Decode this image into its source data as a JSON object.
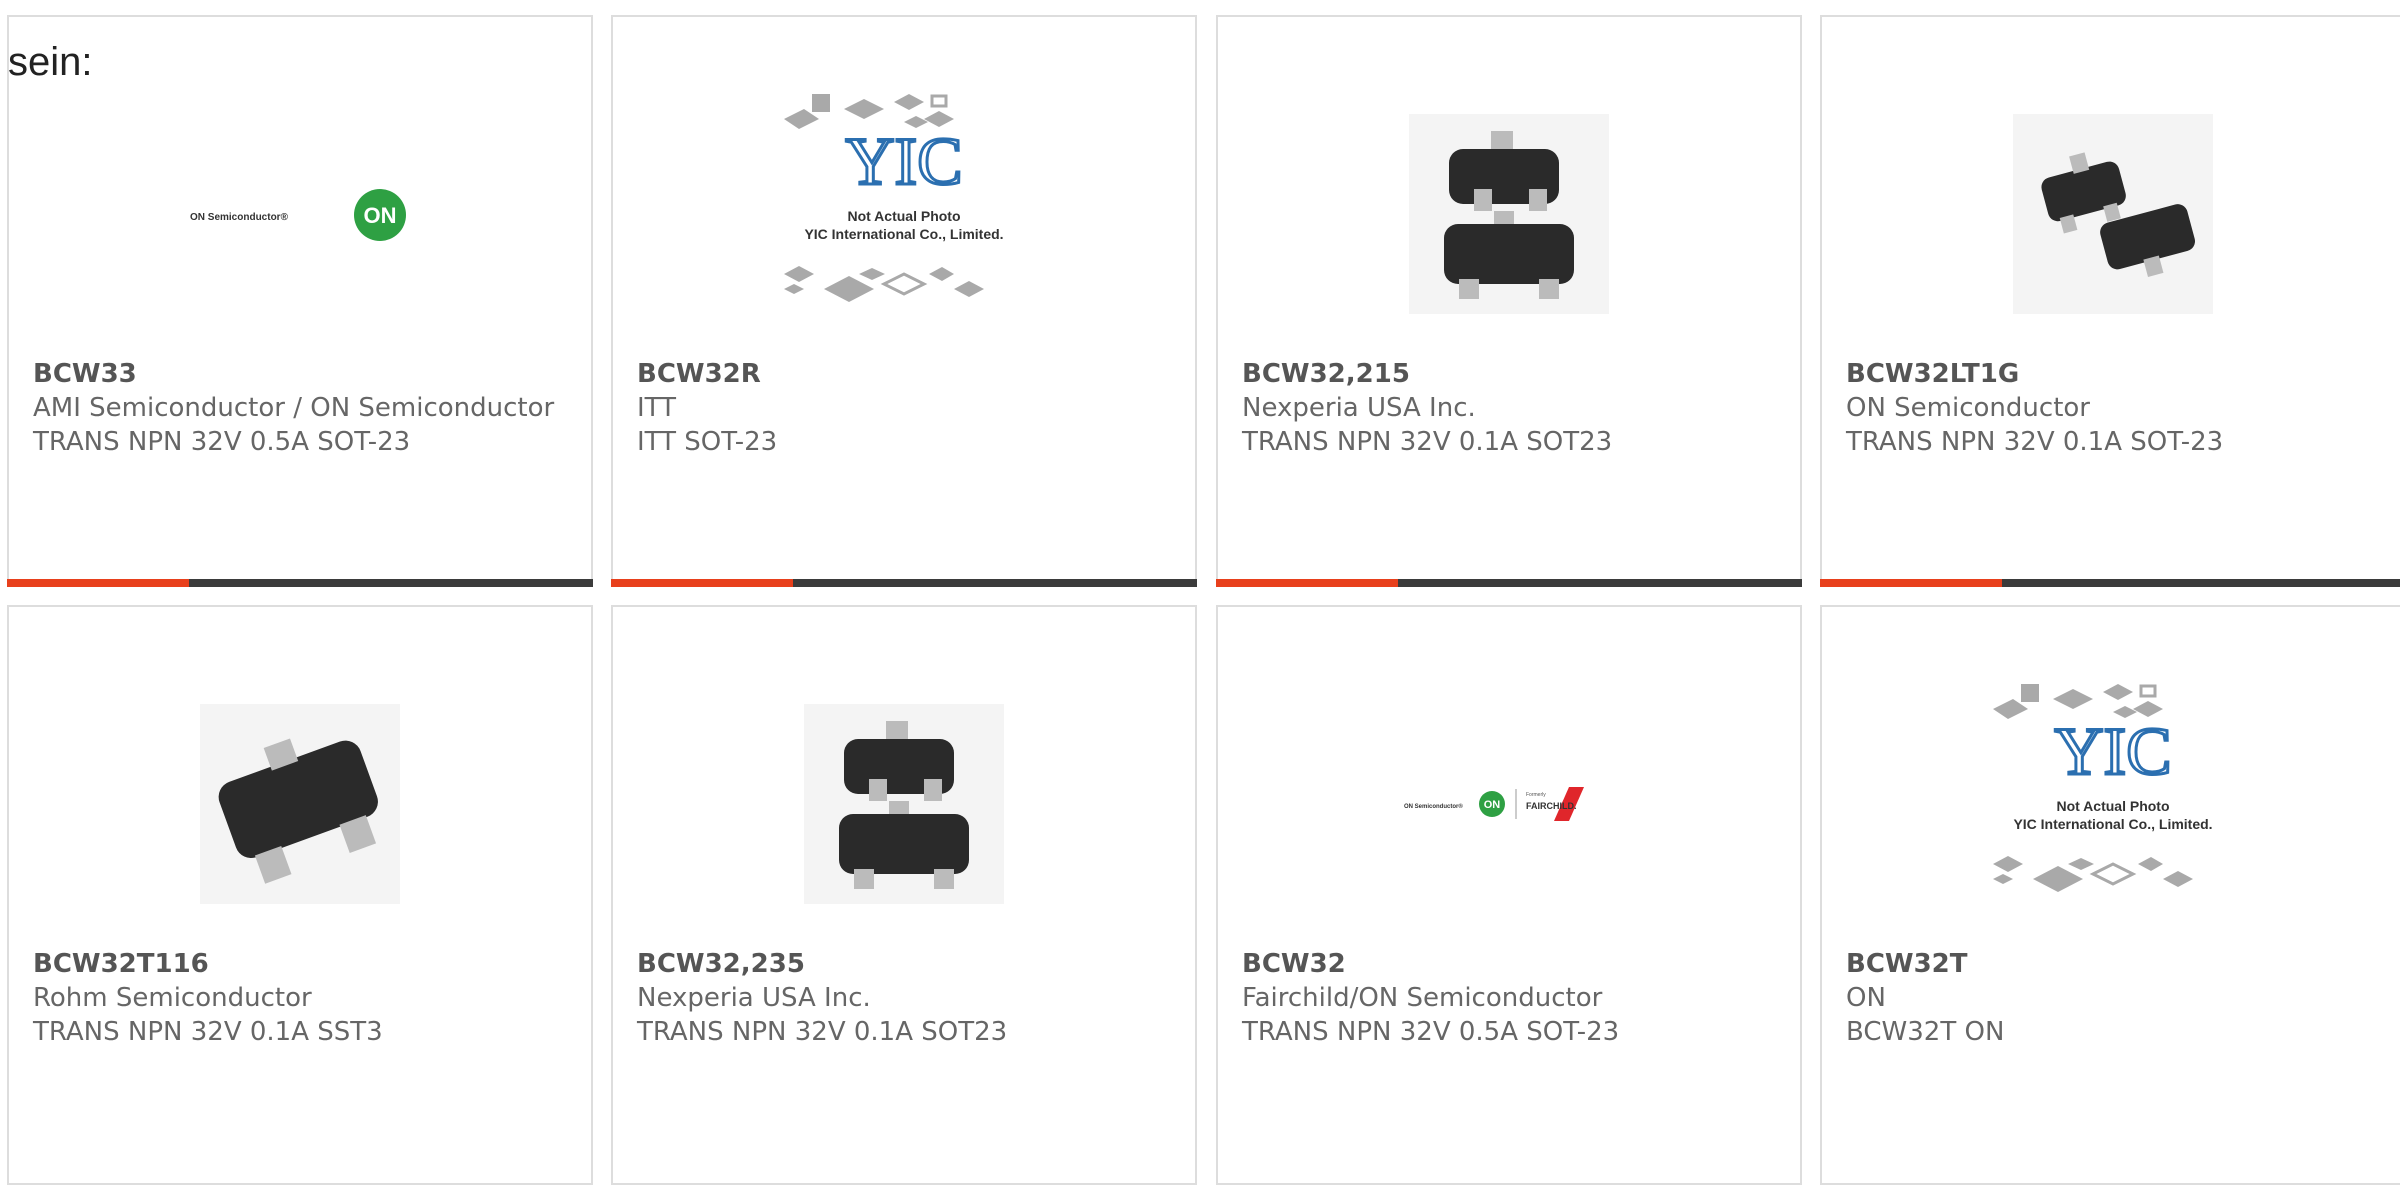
{
  "heading": "sein:",
  "not_actual_photo": {
    "logo": "YIC",
    "line1": "Not Actual Photo",
    "line2": "YIC International Co., Limited."
  },
  "colors": {
    "accent": "#e8401c",
    "bar_dark": "#3b3b3b",
    "on_green": "#2ea043",
    "fairchild_red": "#e0262b"
  },
  "logos": {
    "on_semi_text": "ON Semiconductor®",
    "on_badge": "ON",
    "fairchild_formerly": "Formerly",
    "fairchild_name": "FAIRCHILD."
  },
  "products": [
    {
      "part": "BCW33",
      "manufacturer": "AMI Semiconductor / ON Semiconductor",
      "description": "TRANS NPN 32V 0.5A SOT-23",
      "image": "on-semiconductor-logo"
    },
    {
      "part": "BCW32R",
      "manufacturer": "ITT",
      "description": "ITT SOT-23",
      "image": "not-actual-photo"
    },
    {
      "part": "BCW32,215",
      "manufacturer": "Nexperia USA Inc.",
      "description": "TRANS NPN 32V 0.1A SOT23",
      "image": "sot23-chips"
    },
    {
      "part": "BCW32LT1G",
      "manufacturer": "ON Semiconductor",
      "description": "TRANS NPN 32V 0.1A SOT-23",
      "image": "sot23-chips-tilted"
    },
    {
      "part": "BCW32T116",
      "manufacturer": "Rohm Semiconductor",
      "description": "TRANS NPN 32V 0.1A SST3",
      "image": "sot23-single-chip"
    },
    {
      "part": "BCW32,235",
      "manufacturer": "Nexperia USA Inc.",
      "description": "TRANS NPN 32V 0.1A SOT23",
      "image": "sot23-chips"
    },
    {
      "part": "BCW32",
      "manufacturer": "Fairchild/ON Semiconductor",
      "description": "TRANS NPN 32V 0.5A SOT-23",
      "image": "on-fairchild-logo"
    },
    {
      "part": "BCW32T",
      "manufacturer": "ON",
      "description": "BCW32T ON",
      "image": "not-actual-photo"
    }
  ]
}
